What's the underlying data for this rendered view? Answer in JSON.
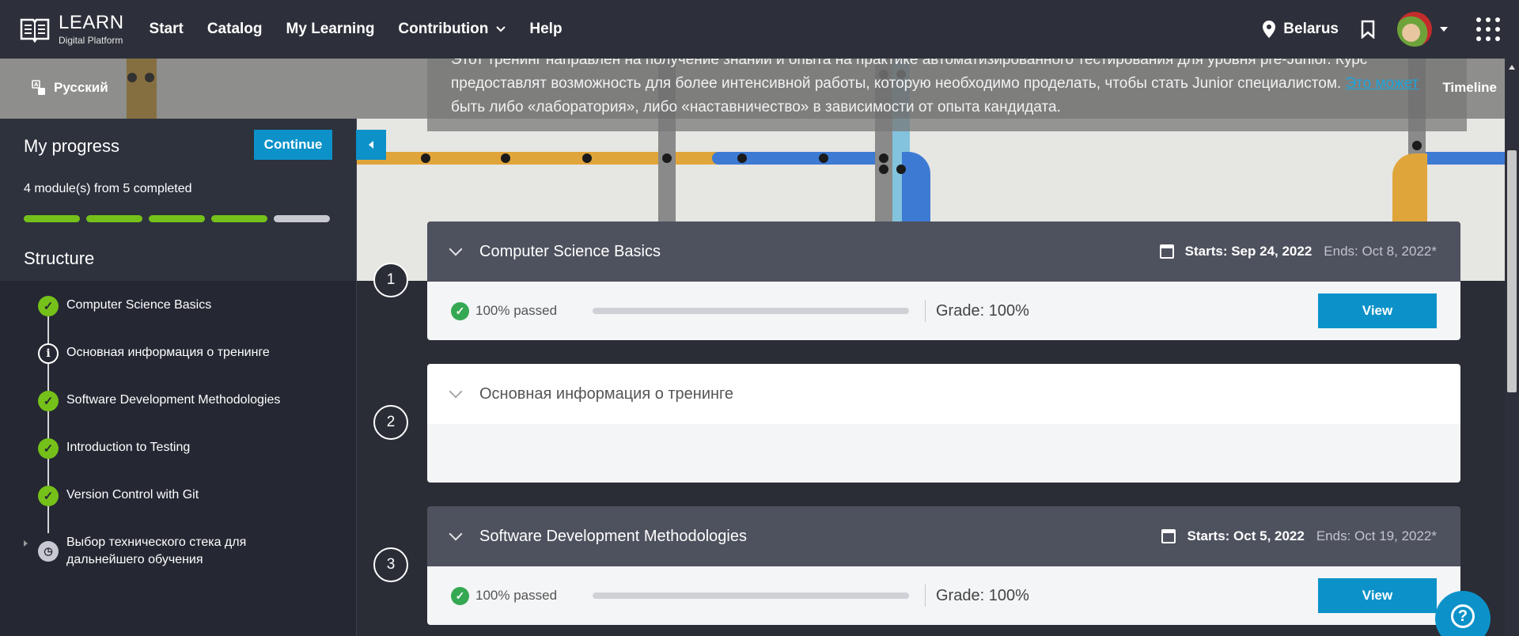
{
  "nav": {
    "logo_title": "LEARN",
    "logo_subtitle": "Digital Platform",
    "items": [
      {
        "label": "Start"
      },
      {
        "label": "Catalog"
      },
      {
        "label": "My Learning"
      },
      {
        "label": "Contribution"
      },
      {
        "label": "Help"
      }
    ],
    "location": "Belarus"
  },
  "course": {
    "language": "Русский",
    "timeline_label": "Timeline",
    "description": "Этот тренинг направлен на получение знаний и опыта на практике автоматизированного тестирования для уровня pre-Junior. Курс предоставлят возможность для более интенсивной работы, которую необходимо проделать, чтобы стать Junior специалистом. ",
    "description_link": "Это может",
    "description_tail": " быть либо «лаборатория», либо «наставничество» в зависимости от опыта кандидата."
  },
  "sidebar": {
    "progress_title": "My progress",
    "continue_label": "Continue",
    "progress_count": "4 module(s) from 5 completed",
    "segments": [
      {
        "status": "done",
        "color": "#75c11a"
      },
      {
        "status": "done",
        "color": "#75c11a"
      },
      {
        "status": "done",
        "color": "#75c11a"
      },
      {
        "status": "done",
        "color": "#75c11a"
      },
      {
        "status": "pending",
        "color": "#c8c9d0"
      }
    ],
    "structure_title": "Structure",
    "structure": [
      {
        "label": "Computer Science Basics",
        "status": "done"
      },
      {
        "label": "Основная информация о тренинге",
        "status": "info"
      },
      {
        "label": "Software Development Methodologies",
        "status": "done"
      },
      {
        "label": "Introduction to Testing",
        "status": "done"
      },
      {
        "label": "Version Control with Git",
        "status": "done"
      },
      {
        "label": "Выбор технического стека для дальнейшего обучения",
        "status": "pending"
      }
    ]
  },
  "modules": [
    {
      "number": "1",
      "title": "Computer Science Basics",
      "starts": "Starts: Sep 24, 2022",
      "ends": "Ends: Oct 8, 2022*",
      "passed": "100% passed",
      "grade": "Grade: 100%",
      "view_label": "View"
    },
    {
      "number": "2",
      "title": "Основная информация о тренинге"
    },
    {
      "number": "3",
      "title": "Software Development Methodologies",
      "starts": "Starts: Oct 5, 2022",
      "ends": "Ends: Oct 19, 2022*",
      "passed": "100% passed",
      "grade": "Grade: 100%",
      "view_label": "View"
    }
  ],
  "colors": {
    "accent": "#0c92c9",
    "success": "#75c11a",
    "nav_bg": "#2d303a"
  }
}
